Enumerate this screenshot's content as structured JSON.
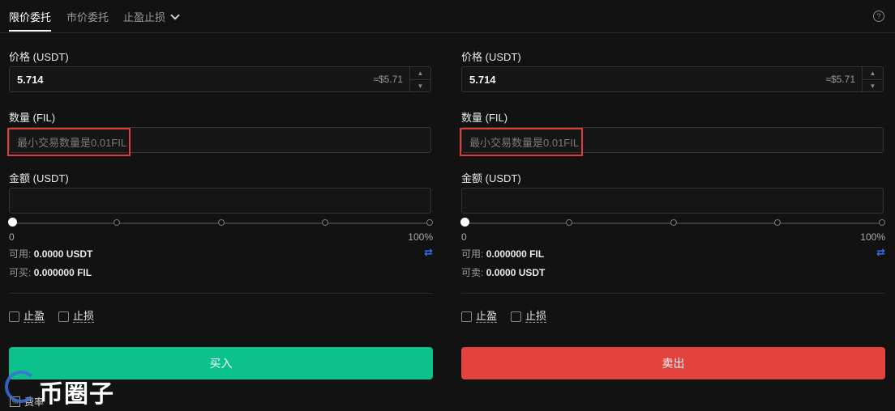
{
  "tabs": {
    "limit": "限价委托",
    "market": "市价委托",
    "stop": "止盈止损"
  },
  "help_icon": "question-circle-icon",
  "buy_panel": {
    "price_label": "价格 (USDT)",
    "price_value": "5.714",
    "price_approx": "≈$5.71",
    "amount_label": "数量 (FIL)",
    "amount_placeholder": "最小交易数量是0.01FIL",
    "total_label": "金额 (USDT)",
    "slider_min": "0",
    "slider_max": "100%",
    "slider_percent": 0,
    "available_label": "可用:",
    "available_value": "0.0000 USDT",
    "can_trade_label": "可买:",
    "can_trade_value": "0.000000 FIL",
    "take_profit": "止盈",
    "stop_loss": "止损",
    "button": "买入",
    "button_color": "#0bc28c"
  },
  "sell_panel": {
    "price_label": "价格 (USDT)",
    "price_value": "5.714",
    "price_approx": "≈$5.71",
    "amount_label": "数量 (FIL)",
    "amount_placeholder": "最小交易数量是0.01FIL",
    "total_label": "金额 (USDT)",
    "slider_min": "0",
    "slider_max": "100%",
    "slider_percent": 0,
    "available_label": "可用:",
    "available_value": "0.000000 FIL",
    "can_trade_label": "可卖:",
    "can_trade_value": "0.0000 USDT",
    "take_profit": "止盈",
    "stop_loss": "止损",
    "button": "卖出",
    "button_color": "#e2443d"
  },
  "footer": {
    "fee_label": "费率",
    "watermark": "币圈子"
  }
}
